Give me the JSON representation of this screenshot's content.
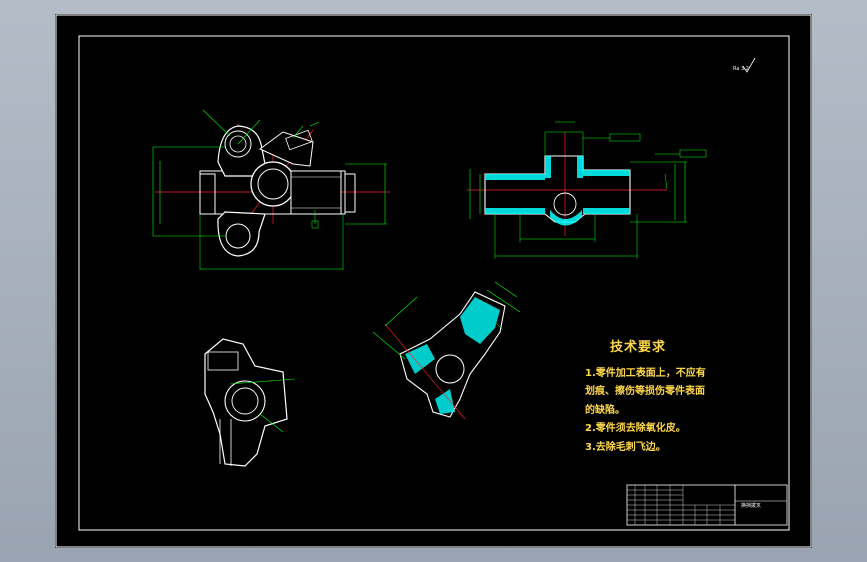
{
  "technical_requirements": {
    "heading": "技术要求",
    "lines": [
      "1.零件加工表面上，不应有",
      "划痕、擦伤等损伤零件表面",
      "的缺陷。",
      "2.零件须去除氧化皮。",
      "3.去除毛刺飞边。"
    ]
  },
  "title_block": {
    "part_name": "换挡拨叉"
  },
  "roughness_note": "Ra 3.2",
  "colors": {
    "background": "#000000",
    "outline": "#ffffff",
    "dimension": "#00ff00",
    "centerline": "#ff2020",
    "hatch": "#00ffff",
    "text": "#ffd84a"
  }
}
